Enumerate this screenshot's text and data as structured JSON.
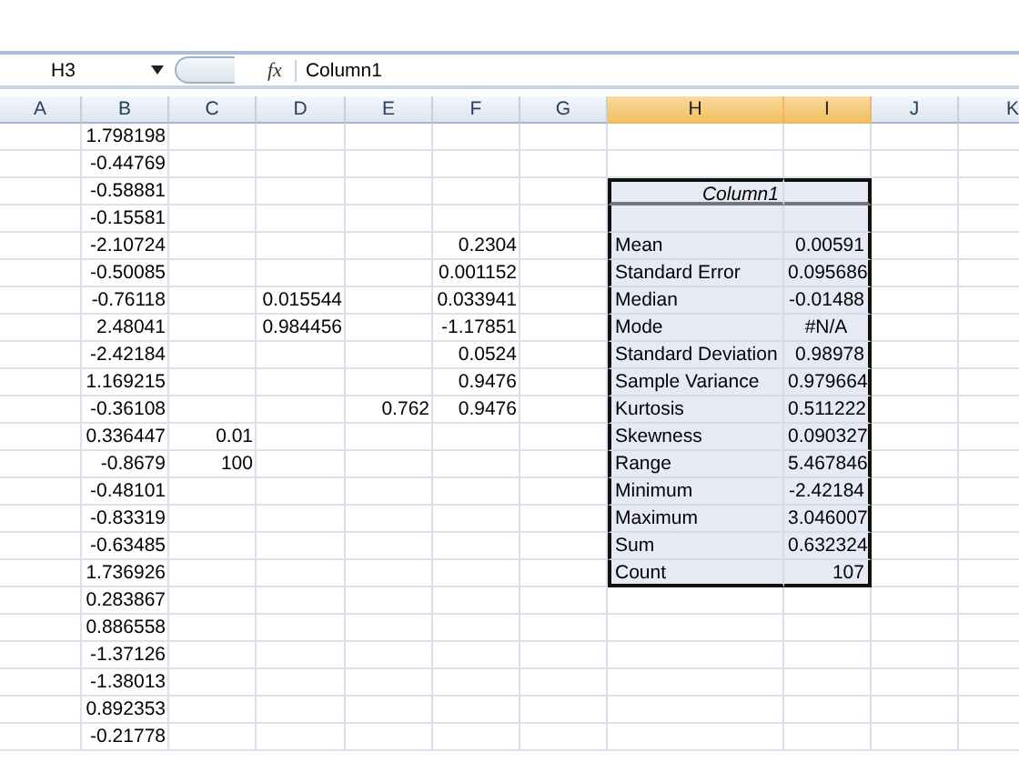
{
  "formula_bar": {
    "name_box": "H3",
    "function_label": "fx",
    "formula": "Column1"
  },
  "columns": [
    {
      "label": "A",
      "selected": false
    },
    {
      "label": "B",
      "selected": false
    },
    {
      "label": "C",
      "selected": false
    },
    {
      "label": "D",
      "selected": false
    },
    {
      "label": "E",
      "selected": false
    },
    {
      "label": "F",
      "selected": false
    },
    {
      "label": "G",
      "selected": false
    },
    {
      "label": "H",
      "selected": true
    },
    {
      "label": "I",
      "selected": true
    },
    {
      "label": "J",
      "selected": false
    },
    {
      "label": "K",
      "selected": false
    }
  ],
  "rows": [
    {
      "B": "1.798198"
    },
    {
      "B": "-0.44769"
    },
    {
      "B": "-0.58881"
    },
    {
      "B": "-0.15581"
    },
    {
      "B": "-2.10724",
      "F": "0.2304"
    },
    {
      "B": "-0.50085",
      "F": "0.001152"
    },
    {
      "B": "-0.76118",
      "D": "0.015544",
      "F": "0.033941"
    },
    {
      "B": "2.48041",
      "D": "0.984456",
      "F": "-1.17851"
    },
    {
      "B": "-2.42184",
      "F": "0.0524"
    },
    {
      "B": "1.169215",
      "F": "0.9476"
    },
    {
      "B": "-0.36108",
      "E": "0.762",
      "F": "0.9476"
    },
    {
      "B": "0.336447",
      "C": "0.01"
    },
    {
      "B": "-0.8679",
      "C": "100"
    },
    {
      "B": "-0.48101"
    },
    {
      "B": "-0.83319"
    },
    {
      "B": "-0.63485"
    },
    {
      "B": "1.736926"
    },
    {
      "B": "0.283867"
    },
    {
      "B": "0.886558"
    },
    {
      "B": "-1.37126"
    },
    {
      "B": "-1.38013"
    },
    {
      "B": "0.892353"
    },
    {
      "B": "-0.21778"
    }
  ],
  "summary": {
    "title": "Column1",
    "selected": true,
    "items": [
      {
        "kind": "blank"
      },
      {
        "kind": "number",
        "label": "Mean",
        "value": "0.00591"
      },
      {
        "kind": "number",
        "label": "Standard Error",
        "value": "0.095686"
      },
      {
        "kind": "number",
        "label": "Median",
        "value": "-0.01488"
      },
      {
        "kind": "error",
        "label": "Mode",
        "value": "#N/A"
      },
      {
        "kind": "number",
        "label": "Standard Deviation",
        "value": "0.98978"
      },
      {
        "kind": "number",
        "label": "Sample Variance",
        "value": "0.979664"
      },
      {
        "kind": "number",
        "label": "Kurtosis",
        "value": "0.511222"
      },
      {
        "kind": "number",
        "label": "Skewness",
        "value": "0.090327"
      },
      {
        "kind": "number",
        "label": "Range",
        "value": "5.467846"
      },
      {
        "kind": "number",
        "label": "Minimum",
        "value": "-2.42184"
      },
      {
        "kind": "number",
        "label": "Maximum",
        "value": "3.046007"
      },
      {
        "kind": "number",
        "label": "Sum",
        "value": "0.632324"
      },
      {
        "kind": "number",
        "label": "Count",
        "value": "107"
      }
    ]
  }
}
